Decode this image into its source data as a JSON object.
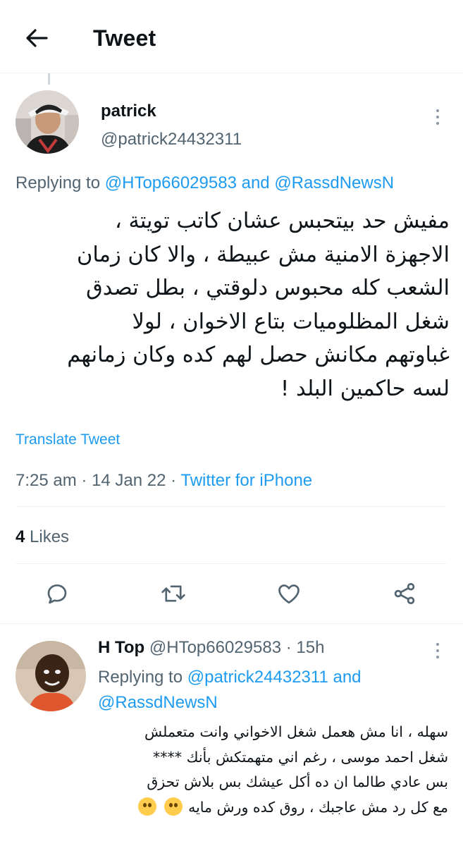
{
  "header": {
    "title": "Tweet",
    "back_icon": "arrow-left-icon"
  },
  "main_tweet": {
    "display_name": "patrick",
    "handle": "@patrick24432311",
    "replying_prefix": "Replying to",
    "replying_user1": "@HTop66029583",
    "replying_and": "and",
    "replying_user2": "@RassdNewsN",
    "text_lines": [
      "مفيش حد بيتحبس عشان كاتب تويتة ،",
      "الاجهزة الامنية مش عبيطة ، والا كان زمان",
      "الشعب كله محبوس دلوقتي ، بطل تصدق",
      "شغل المظلوميات بتاع الاخوان ، لولا",
      "غباوتهم مكانش حصل لهم كده وكان زمانهم",
      "لسه حاكمين البلد !"
    ],
    "translate_label": "Translate Tweet",
    "time": "7:25 am",
    "date": "14 Jan 22",
    "source": "Twitter for iPhone",
    "likes_count": "4",
    "likes_label": "Likes",
    "actions": [
      "reply-icon",
      "retweet-icon",
      "like-icon",
      "share-icon"
    ]
  },
  "reply_tweet": {
    "display_name": "H Top",
    "handle": "@HTop66029583",
    "age": "15h",
    "replying_prefix": "Replying to",
    "replying_user1": "@patrick24432311",
    "replying_and": "and",
    "replying_user2": "@RassdNewsN",
    "text_lines": [
      "سهله ، انا مش هعمل شغل الاخواني وانت متعملش",
      "شغل احمد موسى ، رغم اني متهمتكش بأنك ****",
      "بس عادي طالما ان ده أكل عيشك بس بلاش تحزق",
      "مع كل رد مش عاجبك ، روق كده ورش مايه"
    ]
  },
  "colors": {
    "accent": "#1d9bf0",
    "text": "#0f1419",
    "secondary": "#536471",
    "divider": "#eff3f4"
  }
}
